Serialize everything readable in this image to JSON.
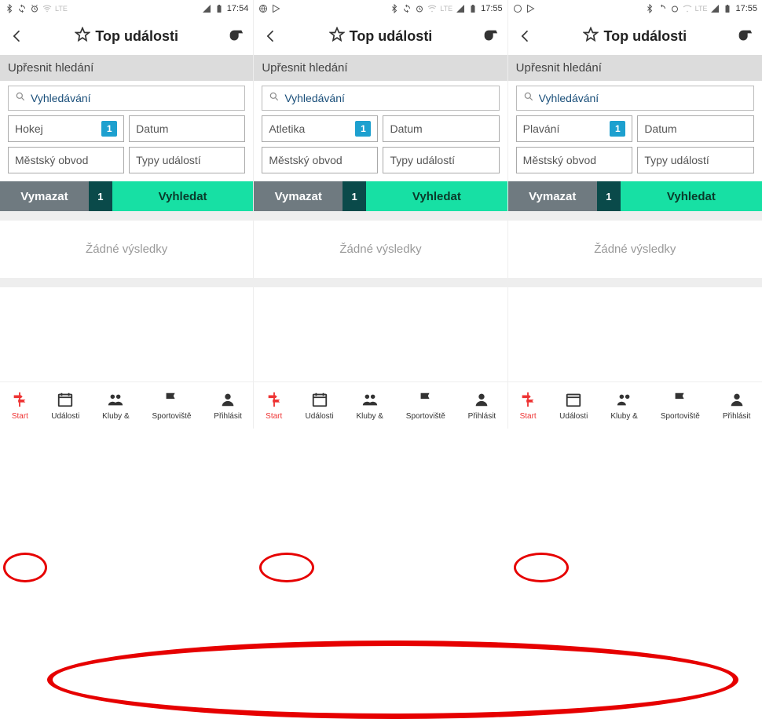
{
  "statusbar": {
    "time1": "17:54",
    "time2": "17:55",
    "time3": "17:55",
    "lte": "LTE"
  },
  "header": {
    "title": "Top události"
  },
  "subheader": {
    "label": "Upřesnit hledání"
  },
  "search": {
    "placeholder": "Vyhledávání"
  },
  "filters": {
    "datum": "Datum",
    "district": "Městský obvod",
    "types": "Typy událostí",
    "badge": "1"
  },
  "sports": {
    "s1": "Hokej",
    "s2": "Atletika",
    "s3": "Plavání"
  },
  "actions": {
    "clear": "Vymazat",
    "count": "1",
    "search": "Vyhledat"
  },
  "results": {
    "empty": "Žádné výsledky"
  },
  "nav": {
    "start": "Start",
    "events": "Události",
    "clubs": "Kluby &",
    "venues": "Sportoviště",
    "login": "Přihlásit"
  }
}
